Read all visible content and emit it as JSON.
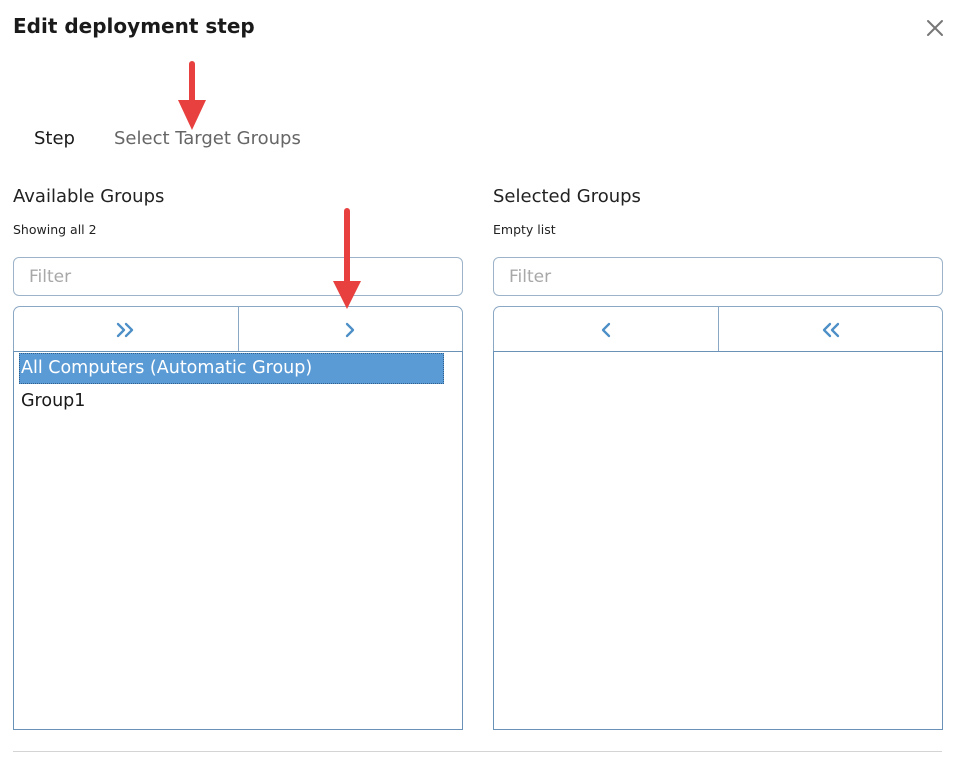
{
  "dialog": {
    "title": "Edit deployment step"
  },
  "tabs": [
    {
      "label": "Step"
    },
    {
      "label": "Select Target Groups"
    }
  ],
  "available": {
    "title": "Available Groups",
    "status": "Showing all 2",
    "filter_placeholder": "Filter",
    "items": [
      {
        "label": "All Computers (Automatic Group)",
        "selected": true
      },
      {
        "label": "Group1",
        "selected": false
      }
    ],
    "buttons": [
      {
        "icon": "double-chevron-right-icon"
      },
      {
        "icon": "chevron-right-icon"
      }
    ]
  },
  "selected": {
    "title": "Selected Groups",
    "status": "Empty list",
    "filter_placeholder": "Filter",
    "items": [],
    "buttons": [
      {
        "icon": "chevron-left-icon"
      },
      {
        "icon": "double-chevron-left-icon"
      }
    ]
  },
  "colors": {
    "accent": "#4d8fc7",
    "selection": "#5b9bd5",
    "annotation_arrow": "#e8403f"
  }
}
